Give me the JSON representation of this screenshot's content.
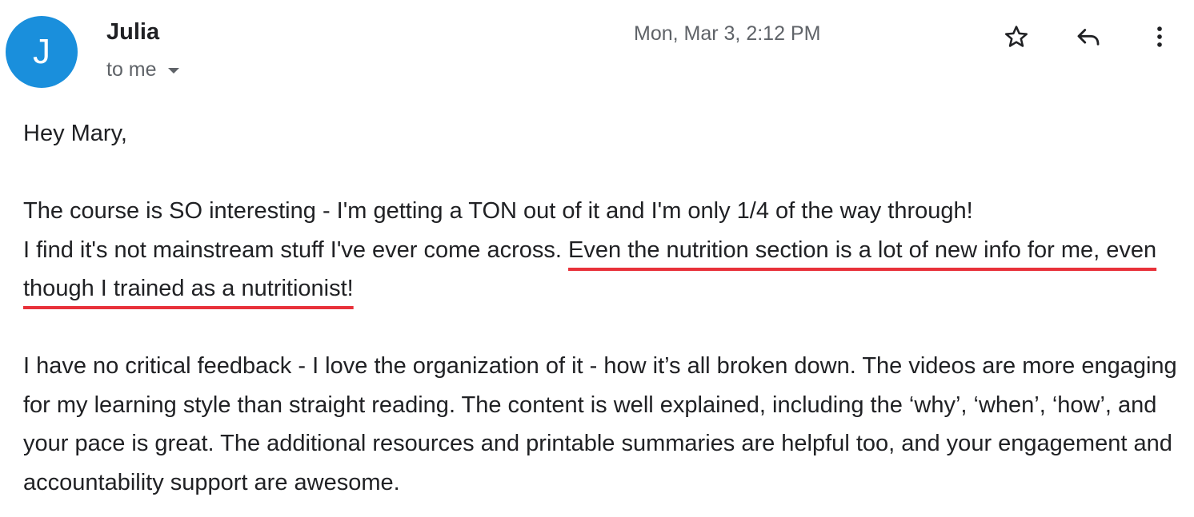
{
  "email": {
    "avatar_initial": "J",
    "avatar_color": "#1a8fdc",
    "sender_name": "Julia",
    "recipient_label": "to me",
    "timestamp": "Mon, Mar 3, 2:12 PM",
    "actions": {
      "star_icon": "star-icon",
      "reply_icon": "reply-icon",
      "more_icon": "more-vert-icon"
    },
    "greeting": "Hey Mary,",
    "paragraph1": {
      "line1": "The course is SO interesting - I'm getting a TON out of it and I'm only 1/4 of the way through!",
      "line2_plain": "I find it's not mainstream stuff I've ever come across. ",
      "highlighted": "Even the nutrition section is a lot of new info for me, even though I trained as a nutritionist!"
    },
    "paragraph2": "I have no critical feedback - I love the organization of it - how it’s all broken down. The videos are more engaging for my learning style than straight reading. The content is well explained, including the ‘why’, ‘when’, ‘how’, and your pace is great. The additional resources and printable summaries are helpful too, and your engagement and accountability support are awesome.",
    "highlight_color": "#e8313a"
  }
}
